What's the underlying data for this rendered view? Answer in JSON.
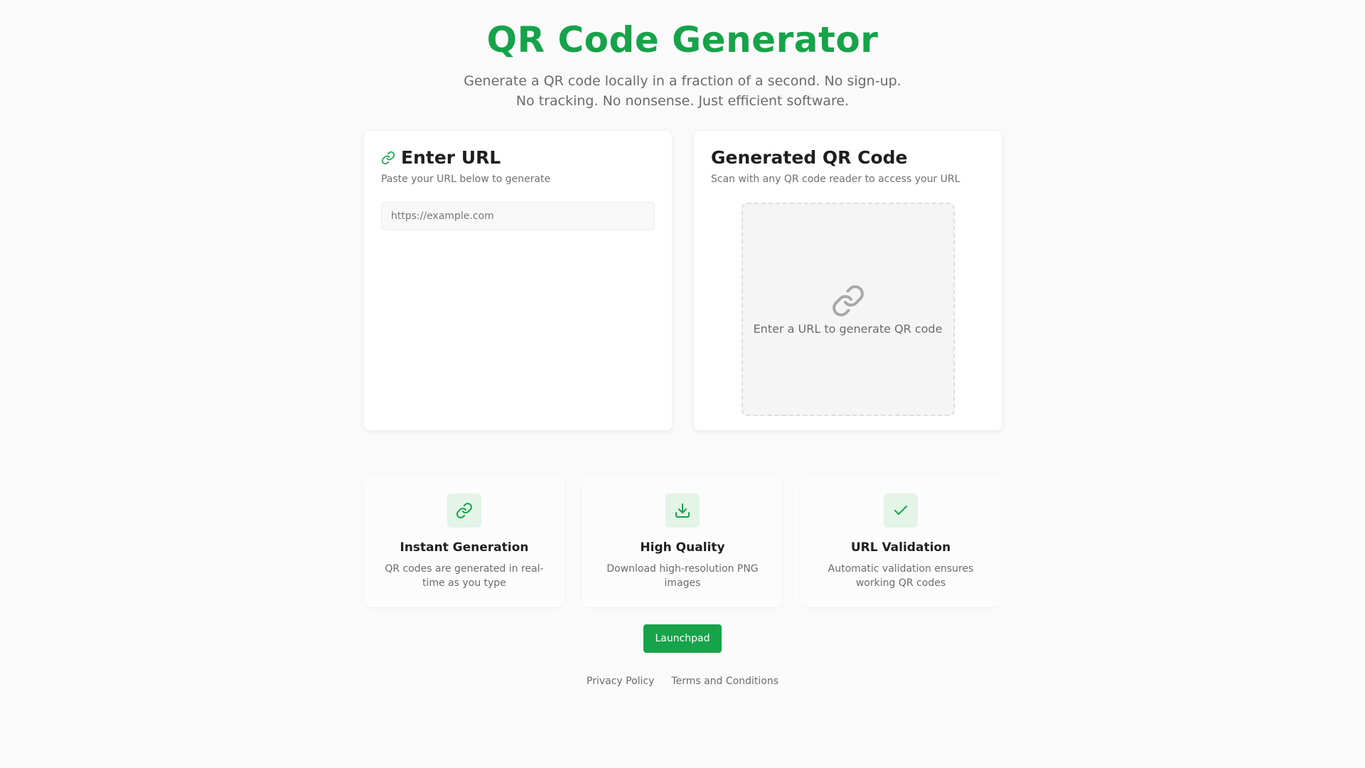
{
  "header": {
    "title": "QR Code Generator",
    "subtitle": "Generate a QR code locally in a fraction of a second. No sign-up. No tracking. No nonsense. Just efficient software."
  },
  "input_card": {
    "icon": "link-icon",
    "title": "Enter URL",
    "subtitle": "Paste your URL below to generate",
    "url_input": {
      "value": "",
      "placeholder": "https://example.com"
    }
  },
  "output_card": {
    "title": "Generated QR Code",
    "subtitle": "Scan with any QR code reader to access your URL",
    "placeholder_icon": "link-icon",
    "placeholder_text": "Enter a URL to generate QR code"
  },
  "features": [
    {
      "icon": "link-icon",
      "title": "Instant Generation",
      "description": "QR codes are generated in real-time as you type"
    },
    {
      "icon": "download-icon",
      "title": "High Quality",
      "description": "Download high-resolution PNG images"
    },
    {
      "icon": "check-icon",
      "title": "URL Validation",
      "description": "Automatic validation ensures working QR codes"
    }
  ],
  "launch_button": {
    "label": "Launchpad"
  },
  "footer": {
    "links": [
      {
        "label": "Privacy Policy"
      },
      {
        "label": "Terms and Conditions"
      }
    ]
  },
  "colors": {
    "accent": "#16a34a",
    "feature_icon_bg": "#e3f4e8",
    "page_background": "#fafafa"
  }
}
